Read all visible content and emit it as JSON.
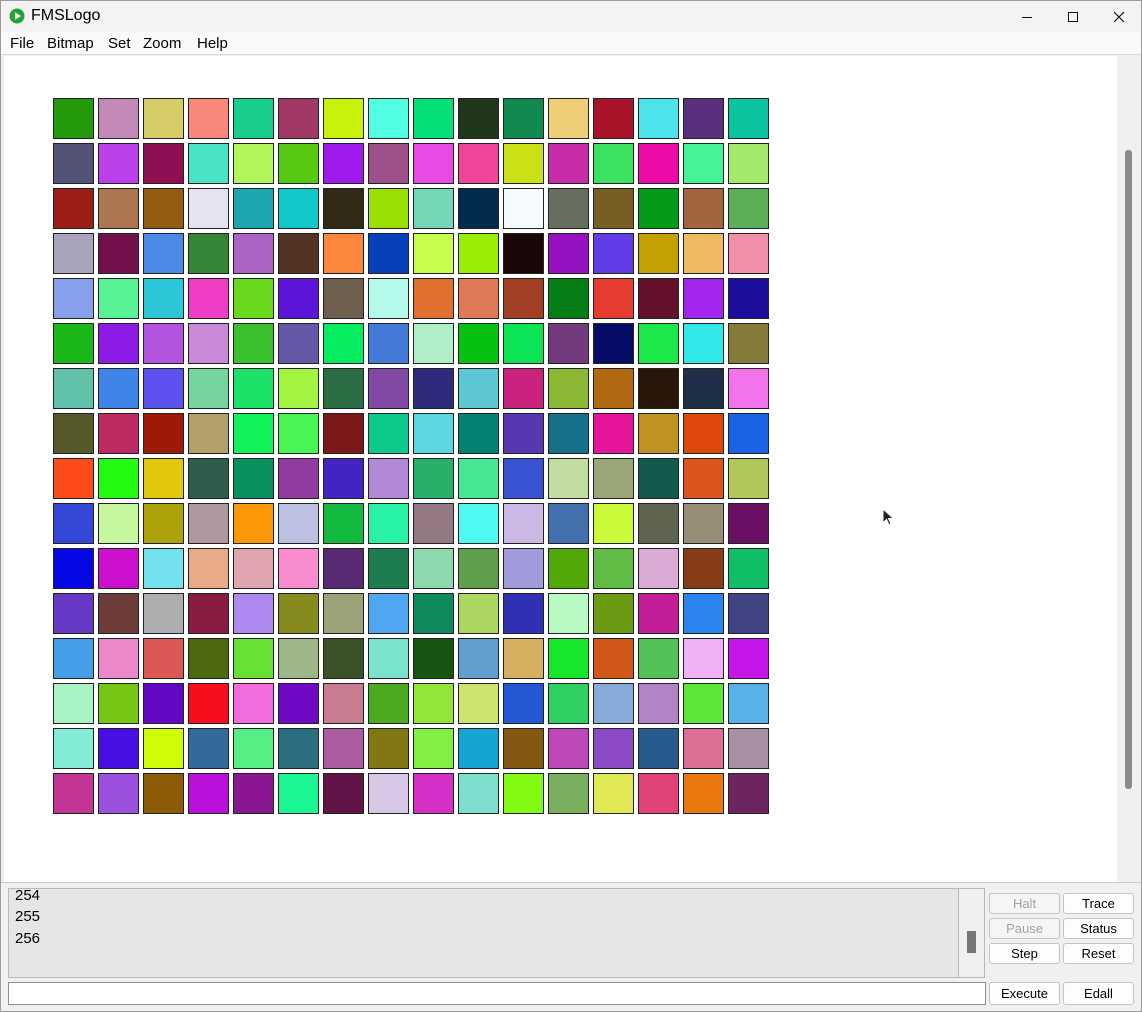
{
  "app": {
    "title": "FMSLogo"
  },
  "icons": {
    "app": "fmslogo-play-icon",
    "minimize": "minimize-icon",
    "maximize": "maximize-icon",
    "close": "close-icon",
    "cursor": "mouse-pointer-icon"
  },
  "menu": [
    "File",
    "Bitmap",
    "Set",
    "Zoom",
    "Help"
  ],
  "palette_swatches": [
    [
      "#229A0B",
      "#C289B6",
      "#D6CC68",
      "#F8887C",
      "#18CE8D",
      "#A23866",
      "#C9F20A",
      "#52FEE1",
      "#05DF77",
      "#1F361A",
      "#108A4F",
      "#EECE76",
      "#A71429",
      "#4AE4EA",
      "#5A2F7E",
      "#0AC49F"
    ],
    [
      "#525376",
      "#B941EA",
      "#8E0F52",
      "#48E3C5",
      "#B2F65C",
      "#58C913",
      "#9D1BEC",
      "#9E5088",
      "#E64CE3",
      "#F04498",
      "#CCE115",
      "#C72DA8",
      "#3CE15F",
      "#EC0AA8",
      "#47F394",
      "#A2EB6A"
    ],
    [
      "#9B1F17",
      "#AB7650",
      "#925C11",
      "#E6E2F0",
      "#1AA7B0",
      "#11C8CB",
      "#302A16",
      "#99DE05",
      "#74D6B7",
      "#032B4E",
      "#F6FAFE",
      "#666E5E",
      "#795E21",
      "#059B19",
      "#A46440",
      "#5CAE59"
    ],
    [
      "#A9A4BC",
      "#71104A",
      "#4B8AE6",
      "#368537",
      "#AB64C6",
      "#523427",
      "#FB873D",
      "#0641BB",
      "#C8FC4E",
      "#99EE05",
      "#1A0708",
      "#9611C2",
      "#623CE6",
      "#C2A105",
      "#EFBA62",
      "#F290AA"
    ],
    [
      "#86A0EC",
      "#57F394",
      "#2DC6D9",
      "#F03DC5",
      "#68D91D",
      "#5D16D9",
      "#6E5F4E",
      "#B4F9EB",
      "#E0702F",
      "#DF7958",
      "#A14024",
      "#067E16",
      "#E53D2F",
      "#64102B",
      "#A226EE",
      "#1D0D9C"
    ],
    [
      "#1BB81A",
      "#8E1AE5",
      "#B353E0",
      "#C889D6",
      "#3BC12E",
      "#6359A8",
      "#05EC5E",
      "#447AD8",
      "#B1EDC6",
      "#06C110",
      "#0BE454",
      "#743A7E",
      "#070C66",
      "#1DE84A",
      "#31E8E8",
      "#857B3A"
    ],
    [
      "#61C2A9",
      "#3F84E9",
      "#5D52F0",
      "#78D49E",
      "#1BE167",
      "#A2F440",
      "#2C6D43",
      "#8248A6",
      "#302A7C",
      "#5CC6D2",
      "#CA237F",
      "#8BB734",
      "#B16912",
      "#281609",
      "#1F2F48",
      "#F273EB"
    ],
    [
      "#58592B",
      "#BD2A62",
      "#9E1A08",
      "#B2A06A",
      "#10F257",
      "#48F552",
      "#7A1A18",
      "#0CCA8B",
      "#5ED6E2",
      "#068270",
      "#5738B1",
      "#167188",
      "#E7159A",
      "#BF9323",
      "#DE480A",
      "#1B63E5"
    ],
    [
      "#FE4B1A",
      "#23FB13",
      "#E1C80D",
      "#2E5D4C",
      "#08905D",
      "#913AA0",
      "#4324C3",
      "#B189D6",
      "#29AF6A",
      "#45E994",
      "#3953D4",
      "#C2DD9F",
      "#9AA878",
      "#125A4D",
      "#DC551E",
      "#B2C75B"
    ],
    [
      "#3448D7",
      "#C7F79C",
      "#ACA20A",
      "#AE979E",
      "#FC9908",
      "#BCC1E2",
      "#12BB3F",
      "#28F3A5",
      "#927983",
      "#4EF9F4",
      "#CCB8E5",
      "#4271AE",
      "#C9FB39",
      "#5E644E",
      "#968E76",
      "#6C1065"
    ],
    [
      "#0508E5",
      "#CC11CE",
      "#73E1EE",
      "#E7AB8A",
      "#E0A4AE",
      "#F98CCF",
      "#582A74",
      "#1D7D4E",
      "#8ED8AE",
      "#5F9E4D",
      "#A29BDB",
      "#52A808",
      "#61BC45",
      "#DCABD5",
      "#883C16",
      "#10BE68"
    ],
    [
      "#6538C5",
      "#6E3D3A",
      "#ABADAE",
      "#8A1B43",
      "#AD89F0",
      "#868A1C",
      "#9BA278",
      "#51A6F3",
      "#0F8A5C",
      "#ACD65F",
      "#2F30B4",
      "#B8F9C1",
      "#6A9B13",
      "#C31D97",
      "#2A85EF",
      "#414483"
    ],
    [
      "#469EE8",
      "#EB88C7",
      "#DB5855",
      "#4E680D",
      "#67E134",
      "#9EB688",
      "#3B5229",
      "#7BE3CB",
      "#175412",
      "#639ED0",
      "#D5B061",
      "#17E72A",
      "#D0591A",
      "#52C157",
      "#F1B1F7",
      "#C616E9"
    ],
    [
      "#A9F2C4",
      "#76C613",
      "#6109C3",
      "#F70E1E",
      "#F26BDF",
      "#7009C3",
      "#C97C90",
      "#4CAA1E",
      "#93E637",
      "#CBE46D",
      "#2258D4",
      "#2ED062",
      "#86ABD8",
      "#B184C6",
      "#5DE839",
      "#58B1E8"
    ],
    [
      "#83EBD6",
      "#4710E2",
      "#D1FC07",
      "#34699D",
      "#57EE85",
      "#2B6E80",
      "#AA5DA0",
      "#817813",
      "#82EF44",
      "#14A5D3",
      "#845810",
      "#BC48BA",
      "#8C4BC5",
      "#285A8D",
      "#DD6E96",
      "#A890A4"
    ],
    [
      "#C33696",
      "#9B51DD",
      "#8D5A08",
      "#BB10DA",
      "#8A1791",
      "#1BF592",
      "#621447",
      "#D8C7E5",
      "#D530C8",
      "#7EDFCF",
      "#82FA13",
      "#78AE5E",
      "#E0E955",
      "#E2447A",
      "#E9790E",
      "#6D255F"
    ]
  ],
  "commander": {
    "history": [
      "254",
      "255",
      "256"
    ],
    "input_value": "",
    "buttons": {
      "halt": "Halt",
      "trace": "Trace",
      "pause": "Pause",
      "status": "Status",
      "step": "Step",
      "reset": "Reset",
      "execute": "Execute",
      "edall": "Edall"
    }
  }
}
